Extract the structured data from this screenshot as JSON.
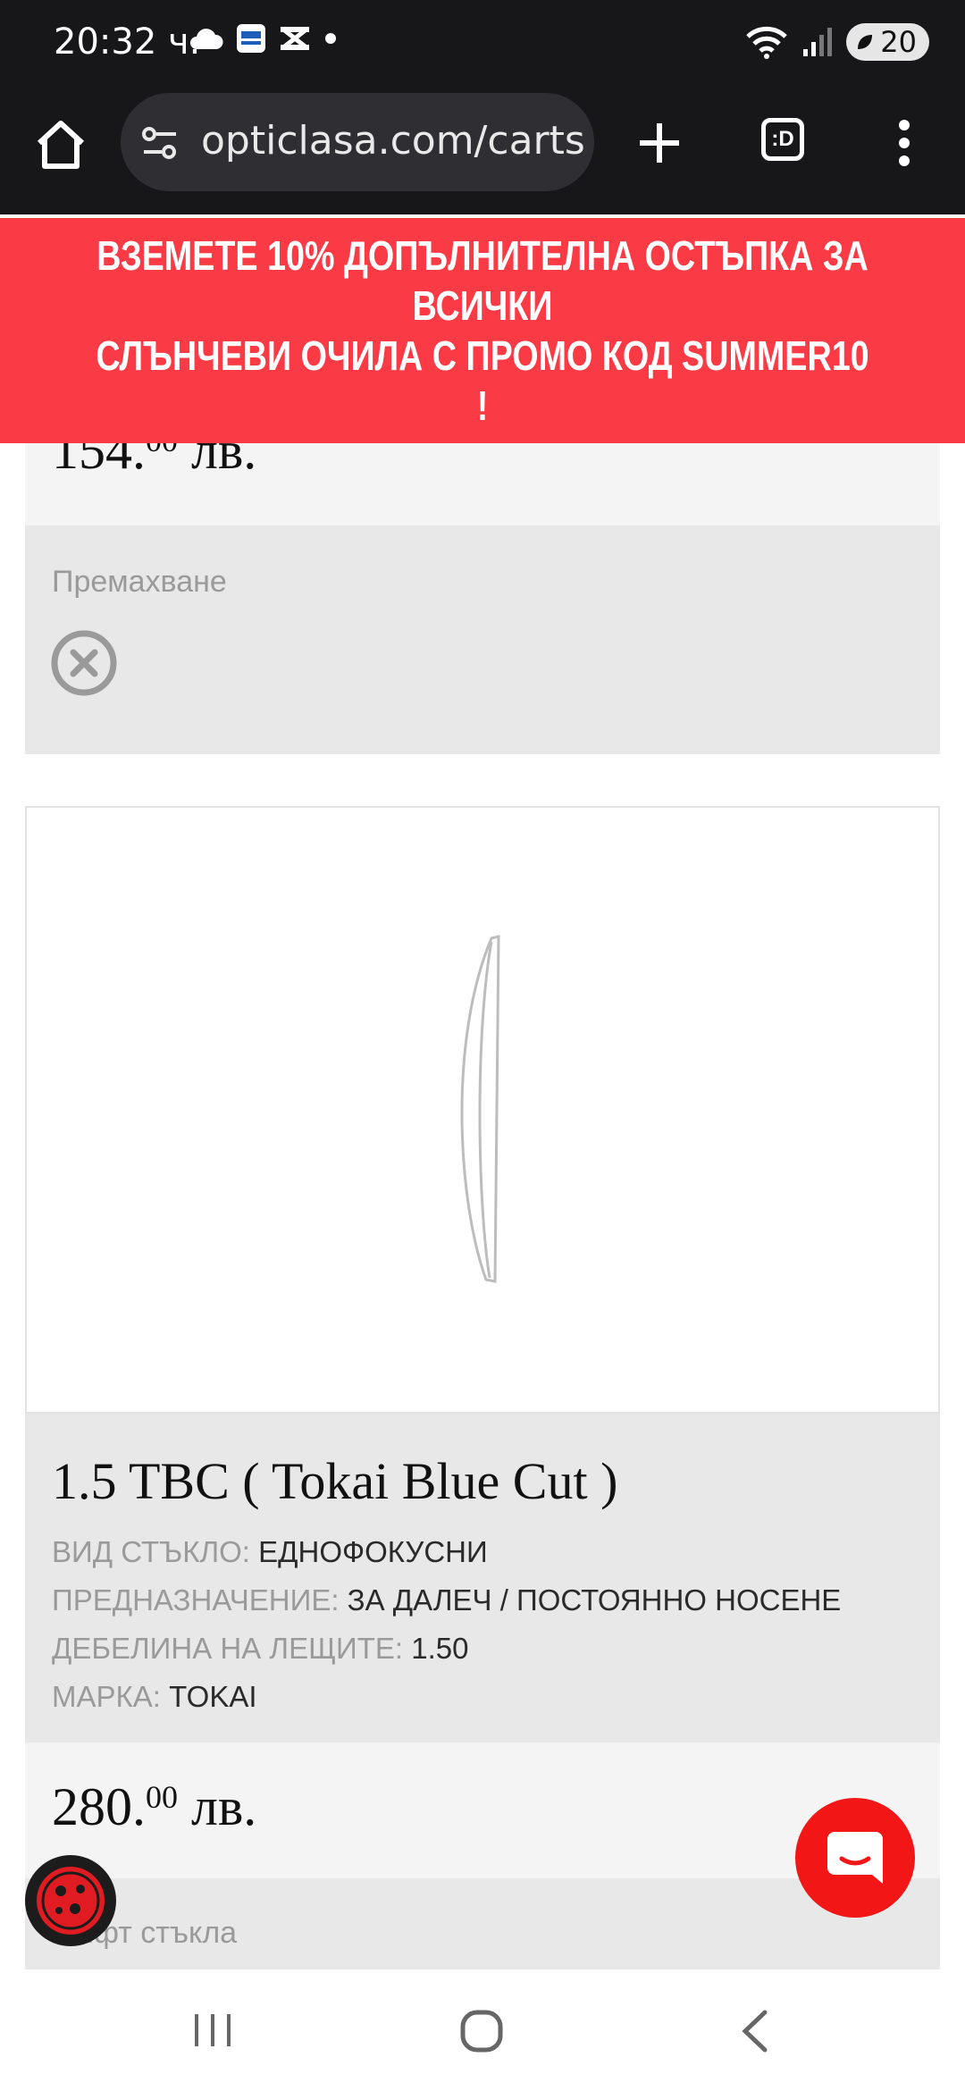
{
  "status": {
    "time": "20:32 ч.",
    "battery": "20"
  },
  "browser": {
    "url": "opticlasa.com/carts",
    "tabs_label": ":D"
  },
  "promo": {
    "line1": "ВЗЕМЕТЕ 10% ДОПЪЛНИТЕЛНА ОСТЪПКА ЗА ВСИЧКИ",
    "line2": "СЛЪНЧЕВИ ОЧИЛА С ПРОМО КОД SUMMER10 !"
  },
  "cart": {
    "item1": {
      "price_main": "154.",
      "price_cents": "00",
      "price_currency": "лв."
    },
    "remove_label": "Премахване",
    "item2": {
      "title": "1.5 TBC ( Tokai Blue Cut )",
      "specs": [
        {
          "key": "ВИД СТЪКЛО:",
          "value": "ЕДНОФОКУСНИ"
        },
        {
          "key": "ПРЕДНАЗНАЧЕНИЕ:",
          "value": "ЗА ДАЛЕЧ / ПОСТОЯННО НОСЕНЕ"
        },
        {
          "key": "ДЕБЕЛИНА НА ЛЕЩИТЕ:",
          "value": "1.50"
        },
        {
          "key": "МАРКА:",
          "value": "TOKAI"
        }
      ],
      "price_main": "280.",
      "price_cents": "00",
      "price_currency": "лв.",
      "bottom_label": "ифт стъкла"
    }
  },
  "colors": {
    "promo_bg": "#fa3a44",
    "chat_fab": "#f21616",
    "chrome_bg": "#17171a"
  }
}
